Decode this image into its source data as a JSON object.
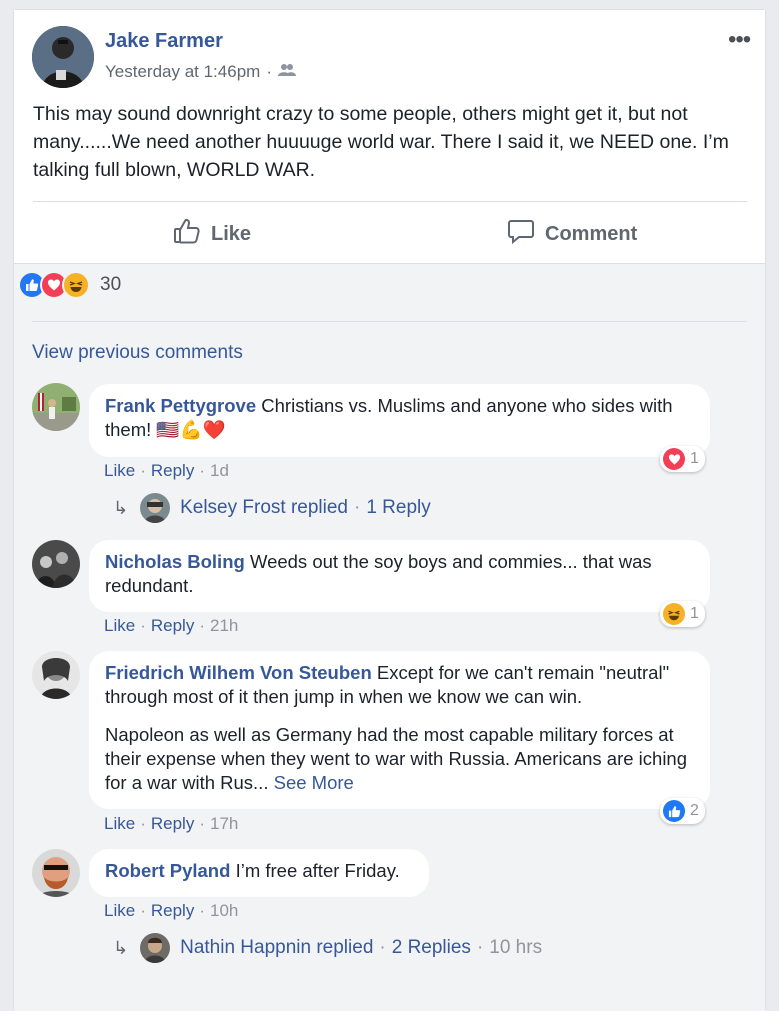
{
  "post": {
    "author": "Jake Farmer",
    "time": "Yesterday at 1:46pm",
    "meta_dot": "·",
    "audience_icon": "friends-icon",
    "more_icon": "•••",
    "text": "This may sound downright crazy to some people, others might get it, but not many......We need another huuuuge world war. There I said it, we NEED one. I’m talking full blown, WORLD WAR."
  },
  "actions": {
    "like": "Like",
    "comment": "Comment"
  },
  "reactions": {
    "count": "30",
    "types": [
      "like",
      "love",
      "haha"
    ]
  },
  "view_previous": "View previous comments",
  "comments": [
    {
      "name": "Frank Pettygrove",
      "text": "Christians vs. Muslims and anyone who sides with them!",
      "emojis": "🇺🇸💪❤️",
      "like": "Like",
      "reply": "Reply",
      "time": "1d",
      "reaction_count": "1",
      "replies": {
        "who": "Kelsey Frost replied",
        "count": "1 Reply"
      }
    },
    {
      "name": "Nicholas Boling",
      "text": "Weeds out the soy boys and commies... that was redundant.",
      "like": "Like",
      "reply": "Reply",
      "time": "21h",
      "reaction_count": "1"
    },
    {
      "name": "Friedrich Wilhem Von Steuben",
      "text": "Except for we can't remain \"neutral\" through most of it then jump in when we know we can win.",
      "text2": "Napoleon as well as Germany had the most capable military forces at their expense when they went to war with Russia. Americans are iching for a war with Rus...",
      "see_more": "See More",
      "like": "Like",
      "reply": "Reply",
      "time": "17h",
      "reaction_count": "2"
    },
    {
      "name": "Robert Pyland",
      "text": "I’m free after Friday.",
      "like": "Like",
      "reply": "Reply",
      "time": "10h",
      "replies": {
        "who": "Nathin Happnin replied",
        "count": "2 Replies",
        "time": "10 hrs"
      }
    }
  ],
  "colors": {
    "link": "#365899",
    "like_blue": "#2078f4",
    "love_red": "#f33e58",
    "haha_yellow": "#f7b125"
  }
}
